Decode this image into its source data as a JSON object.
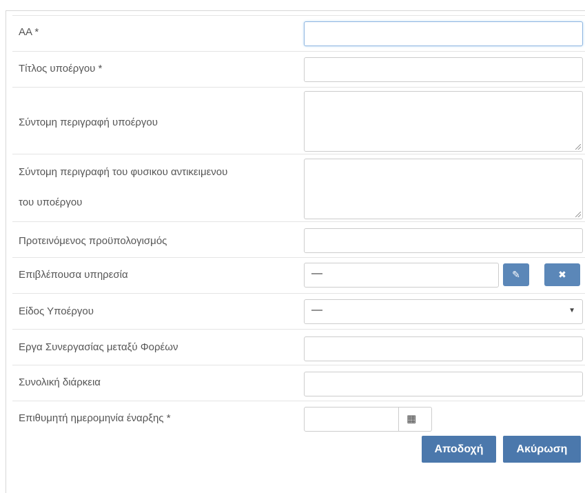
{
  "form": {
    "fields": [
      {
        "label": "ΑΑ *",
        "value": ""
      },
      {
        "label": "Τίτλος υποέργου *",
        "value": ""
      },
      {
        "label": "Σύντομη περιγραφή υποέργου",
        "value": ""
      },
      {
        "label_line1": "Σύντομη περιγραφή του φυσικου αντικειμενου",
        "label_line2": "του υποέργου",
        "value": ""
      },
      {
        "label": "Προτεινόμενος προϋπολογισμός",
        "value": ""
      },
      {
        "label": "Επιβλέπουσα υπηρεσία",
        "value": "—"
      },
      {
        "label": "Είδος Υποέργου",
        "value": "—"
      },
      {
        "label": "Εργα Συνεργασίας μεταξύ Φορέων",
        "value": ""
      },
      {
        "label": "Συνολική διάρκεια",
        "value": ""
      },
      {
        "label": "Επιθυμητή ημερομηνία έναρξης *",
        "value": ""
      }
    ]
  },
  "icons": {
    "edit": "pencil-icon",
    "clear": "close-icon",
    "dropdown": "caret-down-icon",
    "calendar": "calendar-icon"
  },
  "glyphs": {
    "edit": "✎",
    "clear": "✖",
    "dropdown": "▼",
    "calendar": "▦"
  },
  "actions": {
    "accept_label": "Αποδοχή",
    "cancel_label": "Ακύρωση"
  },
  "colors": {
    "button_primary": "#4b78ac",
    "icon_button": "#5b87b8",
    "focus_border": "#8fb6e0"
  }
}
